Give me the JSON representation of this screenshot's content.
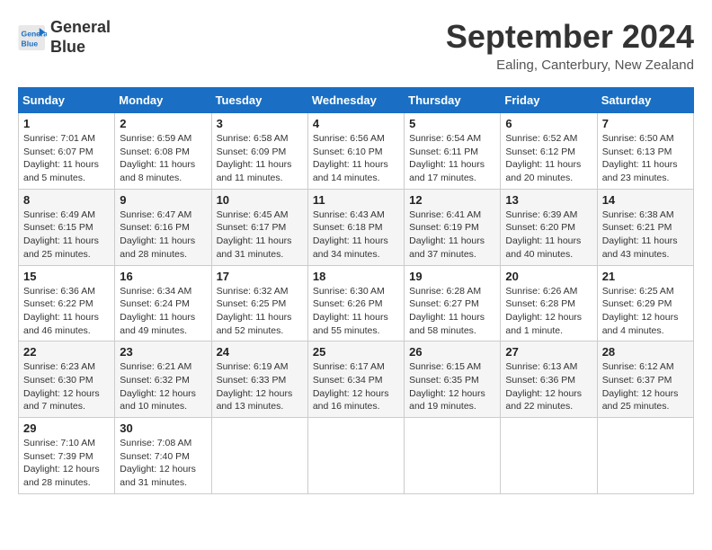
{
  "logo": {
    "line1": "General",
    "line2": "Blue"
  },
  "title": "September 2024",
  "location": "Ealing, Canterbury, New Zealand",
  "days_of_week": [
    "Sunday",
    "Monday",
    "Tuesday",
    "Wednesday",
    "Thursday",
    "Friday",
    "Saturday"
  ],
  "weeks": [
    [
      {
        "day": "1",
        "info": "Sunrise: 7:01 AM\nSunset: 6:07 PM\nDaylight: 11 hours\nand 5 minutes."
      },
      {
        "day": "2",
        "info": "Sunrise: 6:59 AM\nSunset: 6:08 PM\nDaylight: 11 hours\nand 8 minutes."
      },
      {
        "day": "3",
        "info": "Sunrise: 6:58 AM\nSunset: 6:09 PM\nDaylight: 11 hours\nand 11 minutes."
      },
      {
        "day": "4",
        "info": "Sunrise: 6:56 AM\nSunset: 6:10 PM\nDaylight: 11 hours\nand 14 minutes."
      },
      {
        "day": "5",
        "info": "Sunrise: 6:54 AM\nSunset: 6:11 PM\nDaylight: 11 hours\nand 17 minutes."
      },
      {
        "day": "6",
        "info": "Sunrise: 6:52 AM\nSunset: 6:12 PM\nDaylight: 11 hours\nand 20 minutes."
      },
      {
        "day": "7",
        "info": "Sunrise: 6:50 AM\nSunset: 6:13 PM\nDaylight: 11 hours\nand 23 minutes."
      }
    ],
    [
      {
        "day": "8",
        "info": "Sunrise: 6:49 AM\nSunset: 6:15 PM\nDaylight: 11 hours\nand 25 minutes."
      },
      {
        "day": "9",
        "info": "Sunrise: 6:47 AM\nSunset: 6:16 PM\nDaylight: 11 hours\nand 28 minutes."
      },
      {
        "day": "10",
        "info": "Sunrise: 6:45 AM\nSunset: 6:17 PM\nDaylight: 11 hours\nand 31 minutes."
      },
      {
        "day": "11",
        "info": "Sunrise: 6:43 AM\nSunset: 6:18 PM\nDaylight: 11 hours\nand 34 minutes."
      },
      {
        "day": "12",
        "info": "Sunrise: 6:41 AM\nSunset: 6:19 PM\nDaylight: 11 hours\nand 37 minutes."
      },
      {
        "day": "13",
        "info": "Sunrise: 6:39 AM\nSunset: 6:20 PM\nDaylight: 11 hours\nand 40 minutes."
      },
      {
        "day": "14",
        "info": "Sunrise: 6:38 AM\nSunset: 6:21 PM\nDaylight: 11 hours\nand 43 minutes."
      }
    ],
    [
      {
        "day": "15",
        "info": "Sunrise: 6:36 AM\nSunset: 6:22 PM\nDaylight: 11 hours\nand 46 minutes."
      },
      {
        "day": "16",
        "info": "Sunrise: 6:34 AM\nSunset: 6:24 PM\nDaylight: 11 hours\nand 49 minutes."
      },
      {
        "day": "17",
        "info": "Sunrise: 6:32 AM\nSunset: 6:25 PM\nDaylight: 11 hours\nand 52 minutes."
      },
      {
        "day": "18",
        "info": "Sunrise: 6:30 AM\nSunset: 6:26 PM\nDaylight: 11 hours\nand 55 minutes."
      },
      {
        "day": "19",
        "info": "Sunrise: 6:28 AM\nSunset: 6:27 PM\nDaylight: 11 hours\nand 58 minutes."
      },
      {
        "day": "20",
        "info": "Sunrise: 6:26 AM\nSunset: 6:28 PM\nDaylight: 12 hours\nand 1 minute."
      },
      {
        "day": "21",
        "info": "Sunrise: 6:25 AM\nSunset: 6:29 PM\nDaylight: 12 hours\nand 4 minutes."
      }
    ],
    [
      {
        "day": "22",
        "info": "Sunrise: 6:23 AM\nSunset: 6:30 PM\nDaylight: 12 hours\nand 7 minutes."
      },
      {
        "day": "23",
        "info": "Sunrise: 6:21 AM\nSunset: 6:32 PM\nDaylight: 12 hours\nand 10 minutes."
      },
      {
        "day": "24",
        "info": "Sunrise: 6:19 AM\nSunset: 6:33 PM\nDaylight: 12 hours\nand 13 minutes."
      },
      {
        "day": "25",
        "info": "Sunrise: 6:17 AM\nSunset: 6:34 PM\nDaylight: 12 hours\nand 16 minutes."
      },
      {
        "day": "26",
        "info": "Sunrise: 6:15 AM\nSunset: 6:35 PM\nDaylight: 12 hours\nand 19 minutes."
      },
      {
        "day": "27",
        "info": "Sunrise: 6:13 AM\nSunset: 6:36 PM\nDaylight: 12 hours\nand 22 minutes."
      },
      {
        "day": "28",
        "info": "Sunrise: 6:12 AM\nSunset: 6:37 PM\nDaylight: 12 hours\nand 25 minutes."
      }
    ],
    [
      {
        "day": "29",
        "info": "Sunrise: 7:10 AM\nSunset: 7:39 PM\nDaylight: 12 hours\nand 28 minutes."
      },
      {
        "day": "30",
        "info": "Sunrise: 7:08 AM\nSunset: 7:40 PM\nDaylight: 12 hours\nand 31 minutes."
      },
      null,
      null,
      null,
      null,
      null
    ]
  ]
}
